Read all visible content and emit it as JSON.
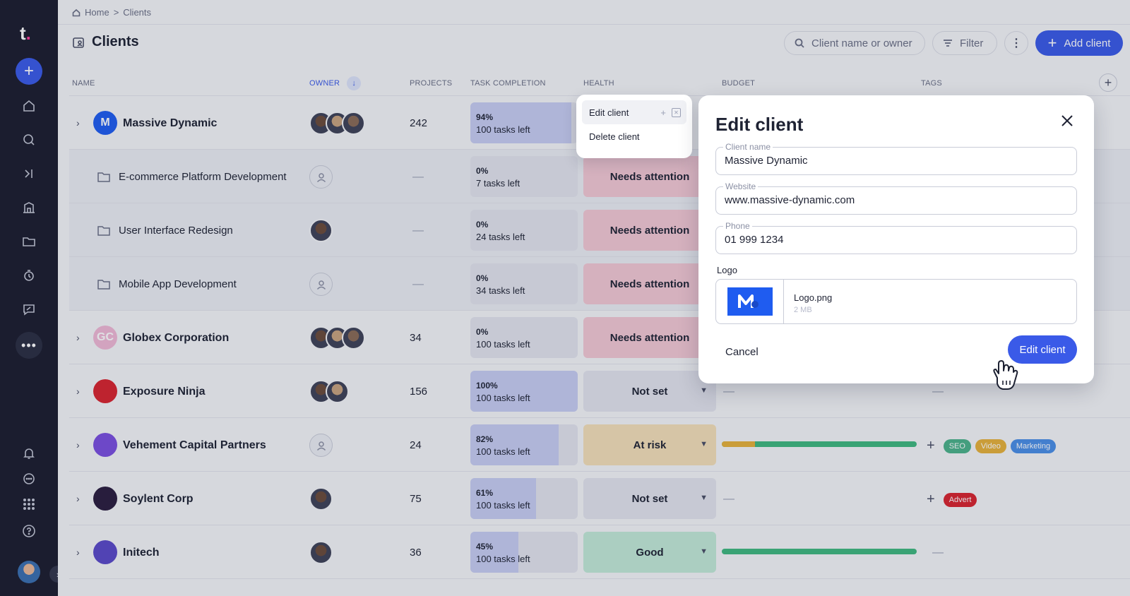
{
  "colors": {
    "accent": "#3a5ae8",
    "sidebar": "#1b1d2e",
    "needs_attention": "#f4c9d4",
    "at_risk": "#f5e0b8",
    "good": "#c3ead8",
    "not_set": "#e3e5ee"
  },
  "sidebar": {
    "logo": "t",
    "items": [
      "home-icon",
      "search-icon",
      "skip-forward-icon",
      "building-icon",
      "folder-icon",
      "timer-icon",
      "chat-icon",
      "more-icon",
      "bell-icon",
      "message-icon",
      "apps-grid-icon",
      "help-icon"
    ]
  },
  "breadcrumb": {
    "home": "Home",
    "separator": ">",
    "current": "Clients"
  },
  "header": {
    "title": "Clients",
    "search_placeholder": "Client name or owner",
    "filter_label": "Filter",
    "add_label": "Add client"
  },
  "table": {
    "columns": {
      "name": "Name",
      "owner": "Owner",
      "projects": "Projects",
      "task_completion": "Task completion",
      "health": "Health",
      "budget": "Budget",
      "tags": "Tags"
    },
    "dash": "—"
  },
  "rows": [
    {
      "type": "client",
      "name": "Massive Dynamic",
      "initials": "M",
      "avatar_color": "#1f5cf0",
      "owners": 3,
      "projects": "242",
      "pct": "94%",
      "pct_value": 94,
      "tasks": "100 tasks left",
      "health": "",
      "budget": null,
      "tags": []
    },
    {
      "type": "sub",
      "name": "E-commerce Platform Development",
      "owners": 0,
      "pct": "0%",
      "pct_value": 0,
      "tasks": "7 tasks left",
      "health": "Needs attention",
      "health_kind": "needs"
    },
    {
      "type": "sub",
      "name": "User Interface Redesign",
      "owners": 1,
      "pct": "0%",
      "pct_value": 0,
      "tasks": "24 tasks left",
      "health": "Needs attention",
      "health_kind": "needs"
    },
    {
      "type": "sub",
      "name": "Mobile App Development",
      "owners": 0,
      "pct": "0%",
      "pct_value": 0,
      "tasks": "34 tasks left",
      "health": "Needs attention",
      "health_kind": "needs"
    },
    {
      "type": "client",
      "name": "Globex Corporation",
      "initials": "GC",
      "avatar_color": "#f0b9d6",
      "owners": 3,
      "projects": "34",
      "pct": "0%",
      "pct_value": 0,
      "tasks": "100 tasks left",
      "health": "Needs attention",
      "health_kind": "needs"
    },
    {
      "type": "client",
      "name": "Exposure Ninja",
      "initials": "",
      "avatar_color": "#d9232e",
      "owners": 2,
      "projects": "156",
      "pct": "100%",
      "pct_value": 100,
      "tasks": "100 tasks left",
      "health": "Not set",
      "health_kind": "notset",
      "budget_dash": true,
      "tags_dash": true
    },
    {
      "type": "client",
      "name": "Vehement Capital Partners",
      "initials": "",
      "avatar_color": "#7b4ee0",
      "owners": 0,
      "projects": "24",
      "pct": "82%",
      "pct_value": 82,
      "tasks": "100 tasks left",
      "health": "At risk",
      "health_kind": "risk",
      "budget_warn": 17,
      "tags": [
        {
          "label": "SEO",
          "color": "#4bb38a"
        },
        {
          "label": "Video",
          "color": "#e7b23a"
        },
        {
          "label": "Marketing",
          "color": "#4a8fe7"
        }
      ]
    },
    {
      "type": "client",
      "name": "Soylent Corp",
      "initials": "",
      "avatar_color": "#2a1d3e",
      "owners": 1,
      "projects": "75",
      "pct": "61%",
      "pct_value": 61,
      "tasks": "100 tasks left",
      "health": "Not set",
      "health_kind": "notset",
      "budget_dash": true,
      "tags": [
        {
          "label": "Advert",
          "color": "#d9232e"
        }
      ]
    },
    {
      "type": "client",
      "name": "Initech",
      "initials": "",
      "avatar_color": "#5a49c9",
      "owners": 1,
      "projects": "36",
      "pct": "45%",
      "pct_value": 45,
      "tasks": "100 tasks left",
      "health": "Good",
      "health_kind": "good",
      "budget_warn": 0,
      "tags_dash": true
    }
  ],
  "context_menu": {
    "edit": "Edit client",
    "delete": "Delete client"
  },
  "modal": {
    "title": "Edit client",
    "client_name_label": "Client name",
    "client_name_value": "Massive Dynamic",
    "website_label": "Website",
    "website_value": "www.massive-dynamic.com",
    "phone_label": "Phone",
    "phone_value": "01 999 1234",
    "logo_label": "Logo",
    "logo_file": "Logo.png",
    "logo_size": "2 MB",
    "cancel_label": "Cancel",
    "submit_label": "Edit client"
  }
}
